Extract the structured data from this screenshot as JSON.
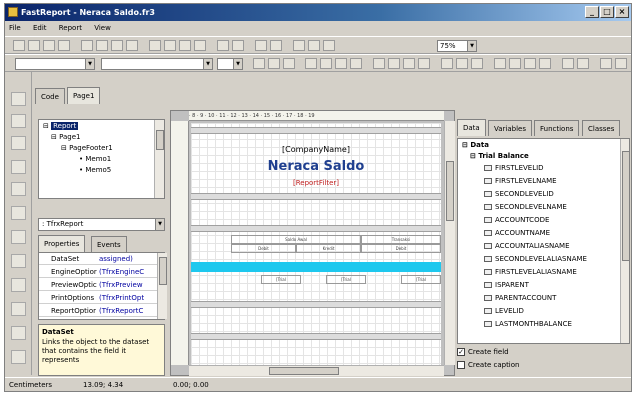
{
  "window": {
    "title": "FastReport - Neraca Saldo.fr3"
  },
  "menu": [
    "File",
    "Edit",
    "Report",
    "View"
  ],
  "toolbar": {
    "zoom": "75%"
  },
  "editor_tabs": [
    "Code",
    "Page1"
  ],
  "report_tree": [
    "Report",
    "Page1",
    "PageFooter1",
    "Memo1",
    "Memo5"
  ],
  "object_combo": ": TfrxReport",
  "inspector_tabs": [
    "Properties",
    "Events"
  ],
  "inspector_rows": [
    {
      "key": "DataSet",
      "value": "assigned)"
    },
    {
      "key": "EngineOptior",
      "value": "(TfrxEngineC"
    },
    {
      "key": "PreviewOptic",
      "value": "(TfrxPreview"
    },
    {
      "key": "PrintOptions",
      "value": "(TfrxPrintOpt"
    },
    {
      "key": "ReportOptior",
      "value": "(TfrxReportC"
    }
  ],
  "help": {
    "title": "DataSet",
    "text": "Links the object to the dataset that contains the field it represents"
  },
  "ruler": "· 8 · 9 · 10 · 11 · 12 · 13 · 14 · 15 · 16 · 17 · 18 · 19",
  "page": {
    "company": "[CompanyName]",
    "title": "Neraca Saldo",
    "filter": "[ReportFilter]",
    "cells": [
      "Saldo Awal",
      "Transaksi",
      "Debit",
      "Kredit",
      "Debit"
    ],
    "fields": [
      "[Trial",
      "[Trial",
      "[Trial"
    ]
  },
  "right_tabs": [
    "Data",
    "Variables",
    "Functions",
    "Classes"
  ],
  "data_tree": {
    "root": "Data",
    "dataset": "Trial Balance",
    "fields": [
      "FIRSTLEVELID",
      "FIRSTLEVELNAME",
      "SECONDLEVELID",
      "SECONDLEVELNAME",
      "ACCOUNTCODE",
      "ACCOUNTNAME",
      "ACCOUNTALIASNAME",
      "SECONDLEVELALIASNAME",
      "FIRSTLEVELALIASNAME",
      "ISPARENT",
      "PARENTACCOUNT",
      "LEVELID",
      "LASTMONTHBALANCE"
    ]
  },
  "options": {
    "create_field": "Create field",
    "create_caption": "Create caption"
  },
  "status": {
    "units": "Centimeters",
    "position": "13.09; 4.34",
    "size": "0.00; 0.00"
  },
  "colors": {
    "title_blue": "#1f3f8f",
    "band_selected": "#1ec8ee",
    "filter_red": "#c02020"
  }
}
